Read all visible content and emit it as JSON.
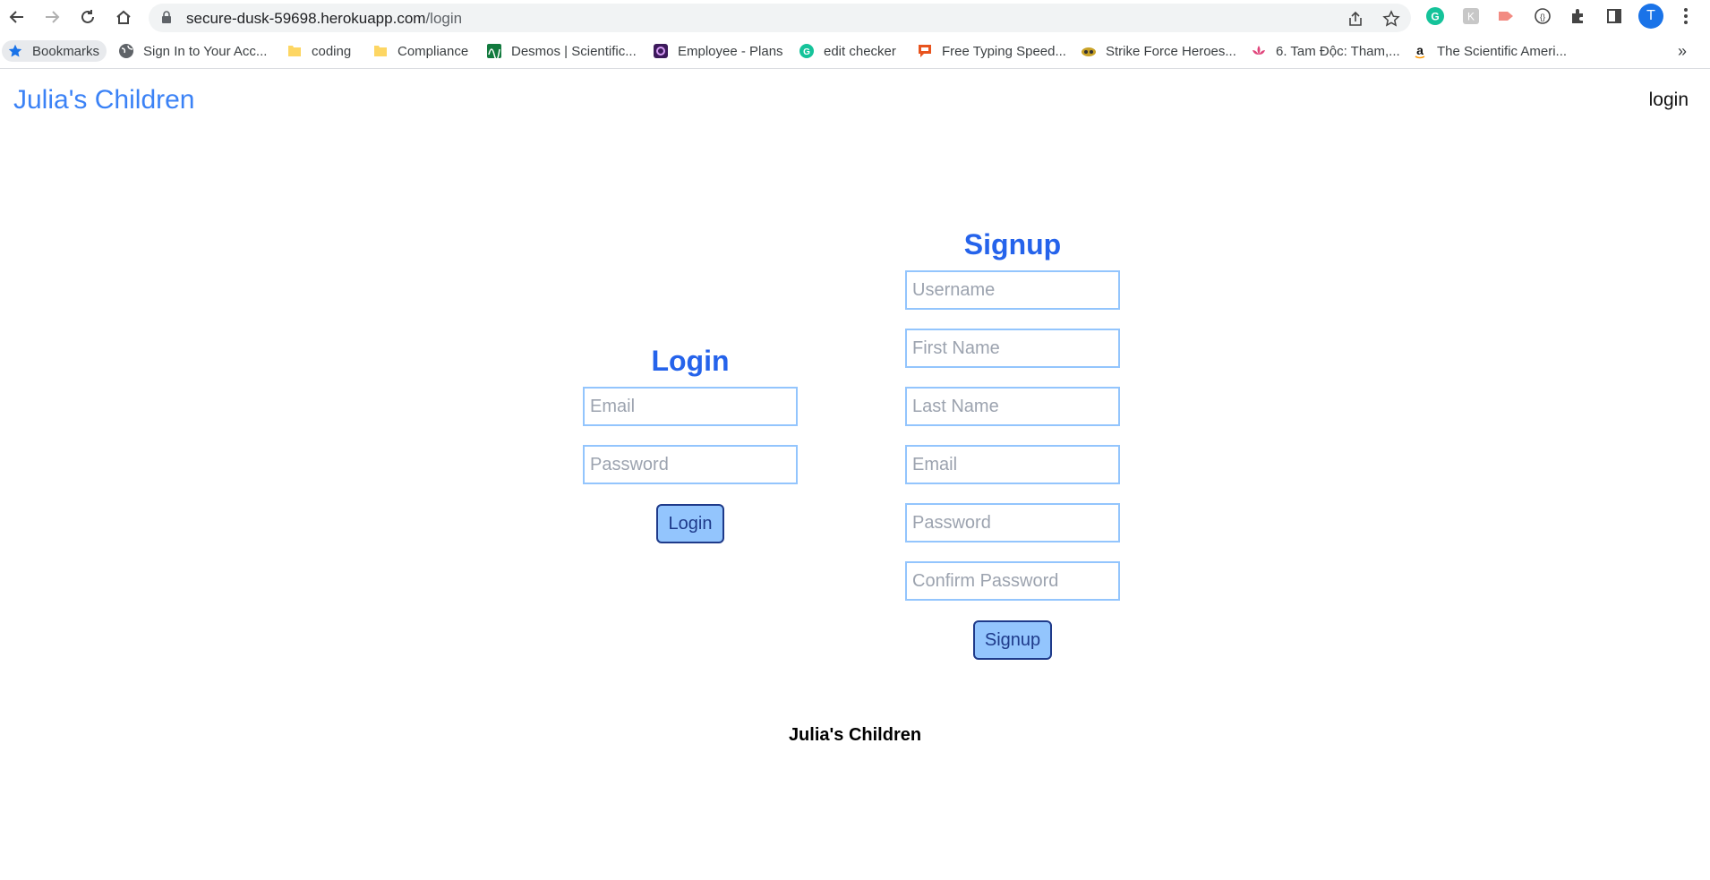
{
  "browser": {
    "url_host": "secure-dusk-59698.herokuapp.com",
    "url_path": "/login",
    "profile_initial": "T",
    "bookmarks": [
      {
        "label": "Bookmarks",
        "icon": "star-icon"
      },
      {
        "label": "Sign In to Your Acc...",
        "icon": "globe-icon"
      },
      {
        "label": "coding",
        "icon": "folder-icon"
      },
      {
        "label": "Compliance",
        "icon": "folder-icon"
      },
      {
        "label": "Desmos | Scientific...",
        "icon": "desmos-icon"
      },
      {
        "label": "Employee - Plans",
        "icon": "employee-icon"
      },
      {
        "label": "edit checker",
        "icon": "grammarly-icon"
      },
      {
        "label": "Free Typing Speed...",
        "icon": "chat-icon"
      },
      {
        "label": "Strike Force Heroes...",
        "icon": "game-icon"
      },
      {
        "label": "6. Tam Độc: Tham,...",
        "icon": "lotus-icon"
      },
      {
        "label": "The Scientific Ameri...",
        "icon": "amazon-icon"
      }
    ],
    "overflow_label": "»"
  },
  "header": {
    "brand": "Julia's Children",
    "login_link": "login"
  },
  "login_form": {
    "title": "Login",
    "email_placeholder": "Email",
    "password_placeholder": "Password",
    "submit_label": "Login"
  },
  "signup_form": {
    "title": "Signup",
    "username_placeholder": "Username",
    "first_name_placeholder": "First Name",
    "last_name_placeholder": "Last Name",
    "email_placeholder": "Email",
    "password_placeholder": "Password",
    "confirm_password_placeholder": "Confirm Password",
    "submit_label": "Signup"
  },
  "footer": {
    "text": "Julia's Children"
  },
  "colors": {
    "brand": "#3b82f6",
    "title": "#2563eb",
    "input_border": "#93c5fd",
    "button_bg": "#93c5fd",
    "button_border": "#1e3a8a"
  }
}
